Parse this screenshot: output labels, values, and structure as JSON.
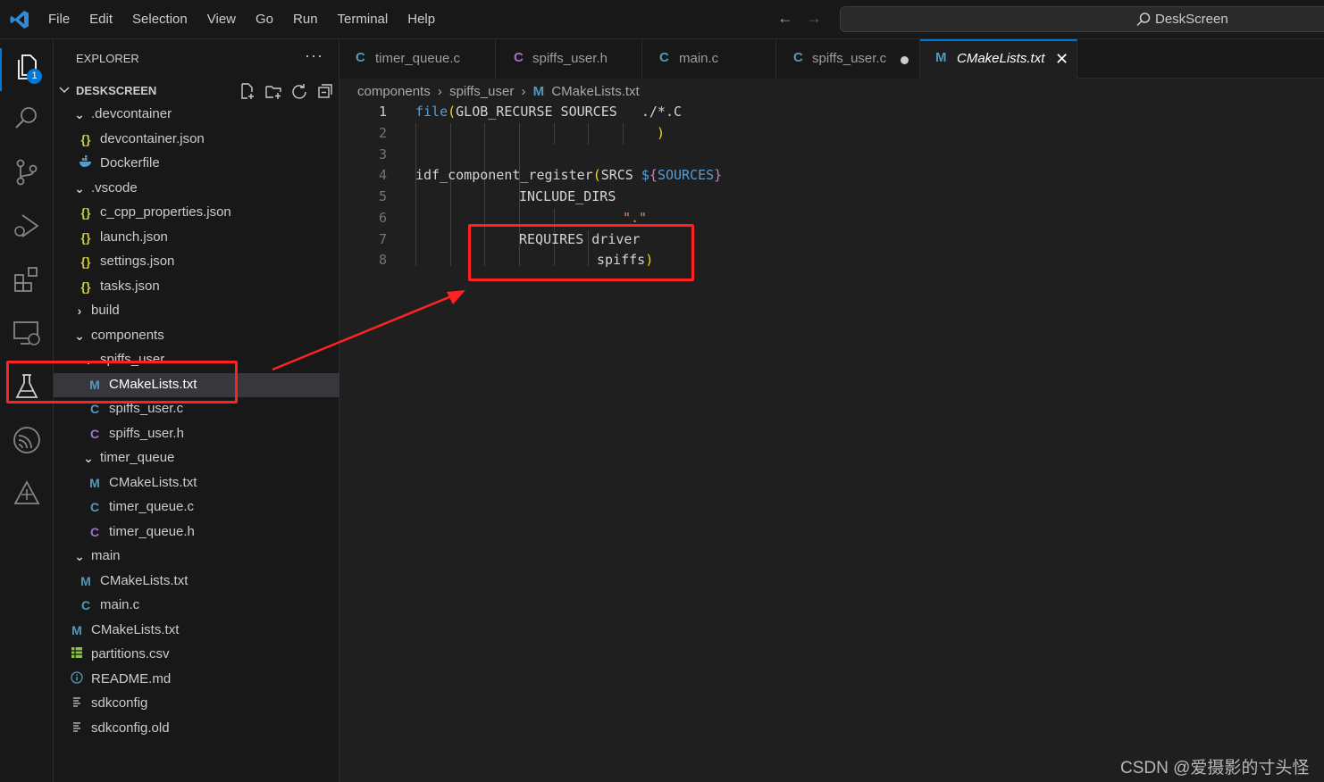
{
  "menu": [
    "File",
    "Edit",
    "Selection",
    "View",
    "Go",
    "Run",
    "Terminal",
    "Help"
  ],
  "search_label": "DeskScreen",
  "explorer_title": "EXPLORER",
  "explorer_more": "···",
  "activity_badge": "1",
  "workspace": "DESKSCREEN",
  "tree": [
    {
      "label": ".devcontainer",
      "icon": "chevron-down"
    },
    {
      "label": "devcontainer.json",
      "icon": "{}"
    },
    {
      "label": "Dockerfile",
      "icon": "docker"
    },
    {
      "label": ".vscode",
      "icon": "chevron-down"
    },
    {
      "label": "c_cpp_properties.json",
      "icon": "{}"
    },
    {
      "label": "launch.json",
      "icon": "{}"
    },
    {
      "label": "settings.json",
      "icon": "{}"
    },
    {
      "label": "tasks.json",
      "icon": "{}"
    },
    {
      "label": "build",
      "icon": "chevron-right"
    },
    {
      "label": "components",
      "icon": "chevron-down"
    },
    {
      "label": "spiffs_user",
      "icon": "chevron-down"
    },
    {
      "label": "CMakeLists.txt",
      "icon": "M"
    },
    {
      "label": "spiffs_user.c",
      "icon": "C"
    },
    {
      "label": "spiffs_user.h",
      "icon": "C"
    },
    {
      "label": "timer_queue",
      "icon": "chevron-down"
    },
    {
      "label": "CMakeLists.txt",
      "icon": "M"
    },
    {
      "label": "timer_queue.c",
      "icon": "C"
    },
    {
      "label": "timer_queue.h",
      "icon": "C"
    },
    {
      "label": "main",
      "icon": "chevron-down"
    },
    {
      "label": "CMakeLists.txt",
      "icon": "M"
    },
    {
      "label": "main.c",
      "icon": "C"
    },
    {
      "label": "CMakeLists.txt",
      "icon": "M"
    },
    {
      "label": "partitions.csv",
      "icon": "table"
    },
    {
      "label": "README.md",
      "icon": "info"
    },
    {
      "label": "sdkconfig",
      "icon": "lines"
    },
    {
      "label": "sdkconfig.old",
      "icon": "lines"
    }
  ],
  "tabs": [
    {
      "label": "timer_queue.c",
      "icon": "C"
    },
    {
      "label": "spiffs_user.h",
      "icon": "C"
    },
    {
      "label": "main.c",
      "icon": "C"
    },
    {
      "label": "spiffs_user.c",
      "icon": "C",
      "modified": true
    },
    {
      "label": "CMakeLists.txt",
      "icon": "M",
      "active": true
    }
  ],
  "breadcrumb": {
    "seg1": "components",
    "seg2": "spiffs_user",
    "seg3": "CMakeLists.txt",
    "file_icon": "M"
  },
  "code": {
    "l1": {
      "kw": "file",
      "p": "(",
      "a": "GLOB_RECURSE SOURCES   ./*.C"
    },
    "l2": ")",
    "l4": {
      "fn": "idf_component_register",
      "p": "(",
      "a": "SRCS ",
      "d": "$",
      "o": "{",
      "v": "SOURCES",
      "c": "}"
    },
    "l5": "INCLUDE_DIRS",
    "l6": "\".\"",
    "l7": "REQUIRES driver",
    "l8a": "spiffs",
    "l8b": ")",
    "line_numbers": [
      "1",
      "2",
      "3",
      "4",
      "5",
      "6",
      "7",
      "8"
    ]
  },
  "watermark": "CSDN @爱摄影的寸头怪"
}
